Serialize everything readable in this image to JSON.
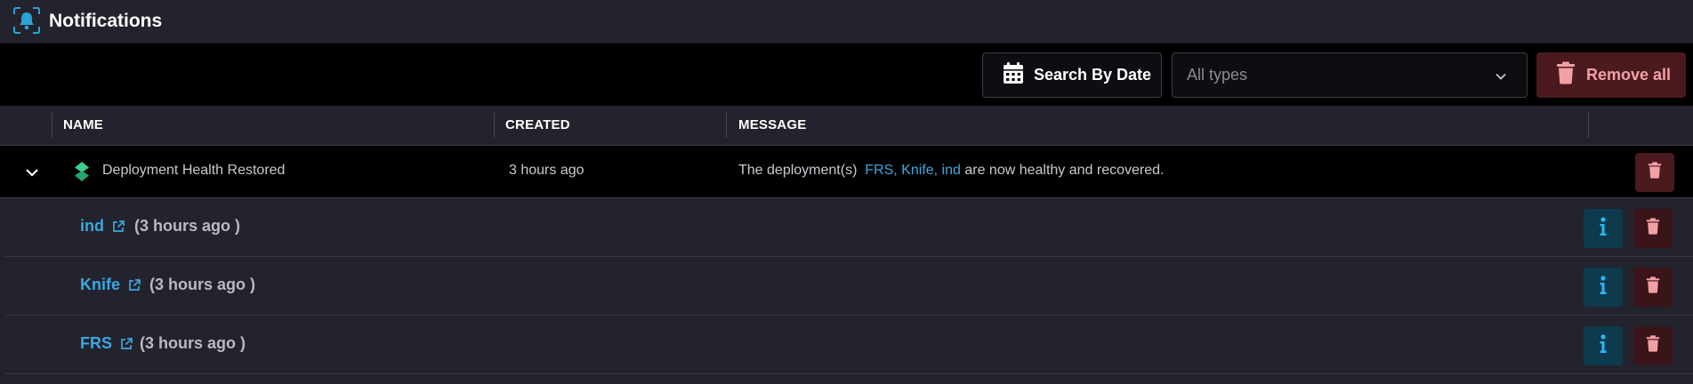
{
  "header": {
    "title": "Notifications",
    "icon": "bell-icon"
  },
  "toolbar": {
    "search_by_date_label": "Search By Date",
    "types_select": {
      "selected": "All types"
    },
    "remove_all_label": "Remove all"
  },
  "table": {
    "columns": [
      "NAME",
      "CREATED",
      "MESSAGE"
    ]
  },
  "notification": {
    "name": "Deployment Health Restored",
    "created": "3 hours ago",
    "message_prefix": "The deployment(s)",
    "message_links": "FRS, Knife, ind",
    "message_suffix": "are now healthy and recovered."
  },
  "deployments": [
    {
      "name": "ind",
      "time": "(3 hours ago )"
    },
    {
      "name": "Knife",
      "time": "(3 hours ago )"
    },
    {
      "name": "FRS",
      "time": "(3 hours ago )"
    }
  ],
  "colors": {
    "accent": "#3ba7e0",
    "danger_bg": "#4a1a1f",
    "danger_fg": "#f3a0a5",
    "info_bg": "#0d3a4d",
    "success": "#3ecf8e"
  }
}
